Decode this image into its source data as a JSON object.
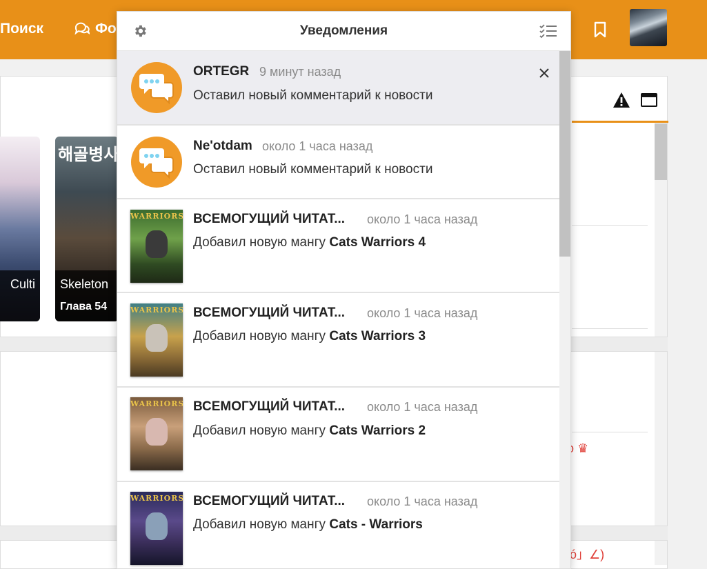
{
  "topbar": {
    "search_label": "Поиск",
    "forum_label": "Фо",
    "accent": "#e89018"
  },
  "background": {
    "cards": [
      {
        "title": "Culti",
        "chapter": ""
      },
      {
        "korean": "해골병사",
        "title": "Skeleton",
        "chapter": "Глава 54"
      }
    ],
    "red_texts": [
      "o ♛",
      "ó」∠)"
    ]
  },
  "notifications": {
    "title": "Уведомления",
    "items": [
      {
        "icon": "comment-bubble-icon",
        "name": "ORTEGR",
        "time": "9 минут назад",
        "text": "Оставил новый комментарий к новости",
        "manga": "",
        "unread": true
      },
      {
        "icon": "comment-bubble-icon",
        "name": "Ne'otdam",
        "time": "около 1 часа назад",
        "text": "Оставил новый комментарий к новости",
        "manga": "",
        "unread": false
      },
      {
        "icon": "manga-cover",
        "name": "ВСЕМОГУЩИЙ ЧИТАТ...",
        "time": "около 1 часа назад",
        "text": "Добавил новую мангу",
        "manga": "Cats Warriors 4",
        "cover_label": "WARRIORS",
        "unread": false
      },
      {
        "icon": "manga-cover",
        "name": "ВСЕМОГУЩИЙ ЧИТАТ...",
        "time": "около 1 часа назад",
        "text": "Добавил новую мангу",
        "manga": "Cats Warriors 3",
        "cover_label": "WARRIORS",
        "unread": false
      },
      {
        "icon": "manga-cover",
        "name": "ВСЕМОГУЩИЙ ЧИТАТ...",
        "time": "около 1 часа назад",
        "text": "Добавил новую мангу",
        "manga": "Cats Warriors 2",
        "cover_label": "WARRIORS",
        "unread": false
      },
      {
        "icon": "manga-cover",
        "name": "ВСЕМОГУЩИЙ ЧИТАТ...",
        "time": "около 1 часа назад",
        "text": "Добавил новую мангу",
        "manga": "Cats - Warriors",
        "cover_label": "WARRIORS",
        "unread": false
      }
    ]
  },
  "colors": {
    "bubble": "#f09a28",
    "bubble_dots": "#7fd3f0"
  }
}
